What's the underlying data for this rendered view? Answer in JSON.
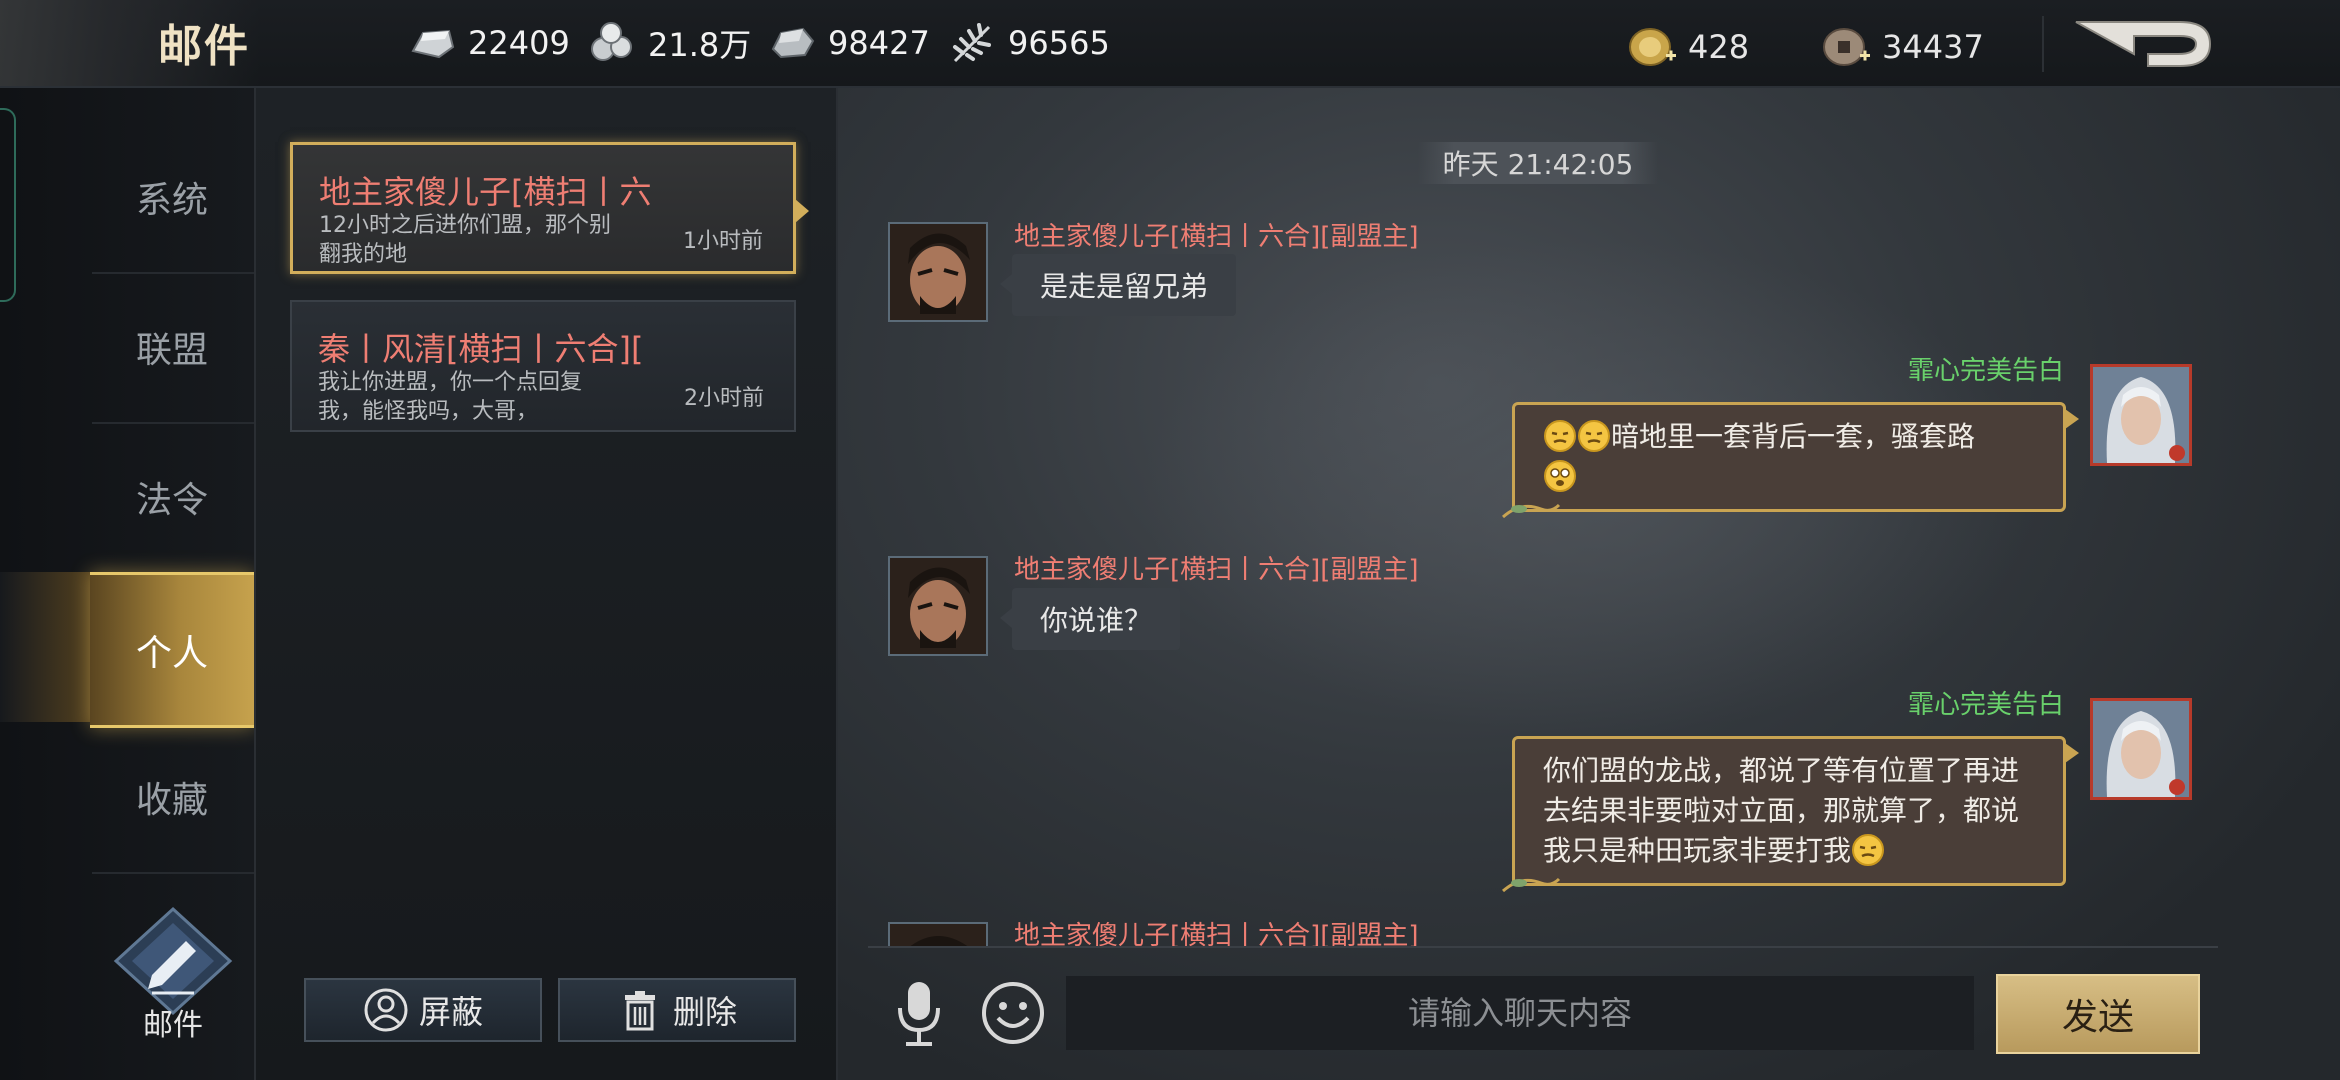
{
  "header": {
    "title": "邮件",
    "resources": [
      {
        "icon": "silver-ingot-icon",
        "value": "22409"
      },
      {
        "icon": "copper-coins-icon",
        "value": "21.8万"
      },
      {
        "icon": "iron-ore-icon",
        "value": "98427"
      },
      {
        "icon": "grain-icon",
        "value": "96565"
      }
    ],
    "currencies": [
      {
        "icon": "gold-coin-plus-icon",
        "value": "428"
      },
      {
        "icon": "copper-coin-plus-icon",
        "value": "34437"
      }
    ],
    "back_icon": "back-arrow-icon"
  },
  "nav": {
    "items": [
      {
        "label": "系统"
      },
      {
        "label": "联盟"
      },
      {
        "label": "法令"
      },
      {
        "label": "个人",
        "active": true
      },
      {
        "label": "收藏"
      }
    ],
    "compose_label": "邮件"
  },
  "mail_list": {
    "items": [
      {
        "name": "地主家傻儿子[横扫丨六",
        "preview": "12小时之后进你们盟，那个别翻我的地",
        "time": "1小时前",
        "selected": true
      },
      {
        "name": "秦丨风清[横扫丨六合][",
        "preview": "我让你进盟，你一个点回复我，能怪我吗，大哥，",
        "time": "2小时前",
        "selected": false
      }
    ],
    "block_label": "屏蔽",
    "delete_label": "删除"
  },
  "chat": {
    "timestamp": "昨天 21:42:05",
    "messages": [
      {
        "side": "left",
        "sender": "地主家傻儿子[横扫丨六合][副盟主]",
        "text": "是走是留兄弟"
      },
      {
        "side": "right",
        "sender": "霏心完美告白",
        "text": "暗地里一套背后一套，骚套路",
        "emojis_before": 2,
        "emojis_after": 1
      },
      {
        "side": "left",
        "sender": "地主家傻儿子[横扫丨六合][副盟主]",
        "text": "你说谁？"
      },
      {
        "side": "right",
        "sender": "霏心完美告白",
        "text": "你们盟的龙战，都说了等有位置了再进去结果非要啦对立面，那就算了，都说我只是种田玩家非要打我",
        "emojis_after": 1
      },
      {
        "side": "left",
        "sender": "地主家傻儿子[横扫丨六合][副盟主]",
        "text": ""
      }
    ],
    "input_placeholder": "请输入聊天内容",
    "send_label": "发送"
  },
  "colors": {
    "gold_accent": "#d2ae5b",
    "enemy_name": "#ef7e73",
    "friend_name": "#69d16b"
  }
}
